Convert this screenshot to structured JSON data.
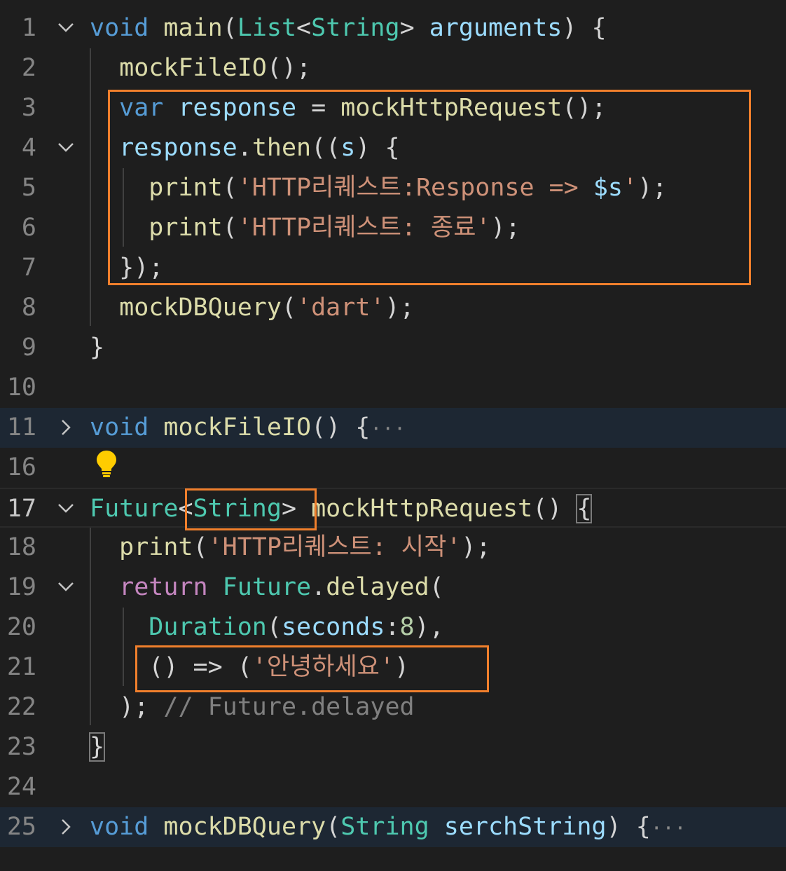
{
  "editor": {
    "theme_colors": {
      "background": "#1e1e1e",
      "keyword": "#569cd6",
      "control": "#c586c0",
      "function": "#dcdcaa",
      "type": "#4ec9b0",
      "variable": "#9cdcfe",
      "string": "#ce9178",
      "comment": "#808080",
      "highlight_box": "#f07f2c"
    },
    "lines": [
      {
        "num": "1",
        "fold": "expanded",
        "tokens": [
          [
            "void",
            "kw"
          ],
          [
            " "
          ],
          [
            "main",
            "fn"
          ],
          [
            "("
          ],
          [
            "List",
            "ty"
          ],
          [
            "<"
          ],
          [
            "String",
            "ty"
          ],
          [
            "> "
          ],
          [
            "arguments",
            "var"
          ],
          [
            ") {"
          ]
        ]
      },
      {
        "num": "2",
        "fold": "",
        "tokens": [
          [
            "  "
          ],
          [
            "mockFileIO",
            "fn"
          ],
          [
            "();"
          ]
        ]
      },
      {
        "num": "3",
        "fold": "",
        "tokens": [
          [
            "  "
          ],
          [
            "var",
            "kw"
          ],
          [
            " "
          ],
          [
            "response",
            "var"
          ],
          [
            " = "
          ],
          [
            "mockHttpRequest",
            "fn"
          ],
          [
            "();"
          ]
        ]
      },
      {
        "num": "4",
        "fold": "expanded",
        "tokens": [
          [
            "  "
          ],
          [
            "response",
            "var"
          ],
          [
            "."
          ],
          [
            "then",
            "fn"
          ],
          [
            "(("
          ],
          [
            "s",
            "var"
          ],
          [
            ") {"
          ]
        ]
      },
      {
        "num": "5",
        "fold": "",
        "tokens": [
          [
            "    "
          ],
          [
            "print",
            "fn"
          ],
          [
            "("
          ],
          [
            "'HTTP리퀘스트:Response => ",
            "str"
          ],
          [
            "$",
            "var"
          ],
          [
            "s",
            "var"
          ],
          [
            "'",
            "str"
          ],
          [
            ");"
          ]
        ]
      },
      {
        "num": "6",
        "fold": "",
        "tokens": [
          [
            "    "
          ],
          [
            "print",
            "fn"
          ],
          [
            "("
          ],
          [
            "'HTTP리퀘스트: 종료'",
            "str"
          ],
          [
            ");"
          ]
        ]
      },
      {
        "num": "7",
        "fold": "",
        "tokens": [
          [
            "  "
          ],
          [
            "});"
          ]
        ]
      },
      {
        "num": "8",
        "fold": "",
        "tokens": [
          [
            "  "
          ],
          [
            "mockDBQuery",
            "fn"
          ],
          [
            "("
          ],
          [
            "'dart'",
            "str"
          ],
          [
            ");"
          ]
        ]
      },
      {
        "num": "9",
        "fold": "",
        "tokens": [
          [
            "}"
          ]
        ]
      },
      {
        "num": "10",
        "fold": "",
        "tokens": []
      },
      {
        "num": "11",
        "fold": "collapsed",
        "tokens": [
          [
            "void",
            "kw"
          ],
          [
            " "
          ],
          [
            "mockFileIO",
            "fn"
          ],
          [
            "() {"
          ],
          [
            "···",
            "ellipsis"
          ]
        ]
      },
      {
        "num": "16",
        "fold": "",
        "tokens": []
      },
      {
        "num": "17",
        "fold": "expanded",
        "active": true,
        "tokens": [
          [
            "Future",
            "ty"
          ],
          [
            "<"
          ],
          [
            "String",
            "ty"
          ],
          [
            "> "
          ],
          [
            "mockHttpRequest",
            "fn"
          ],
          [
            "() "
          ],
          [
            "{",
            "bracket"
          ]
        ]
      },
      {
        "num": "18",
        "fold": "",
        "tokens": [
          [
            "  "
          ],
          [
            "print",
            "fn"
          ],
          [
            "("
          ],
          [
            "'HTTP리퀘스트: 시작'",
            "str"
          ],
          [
            ");"
          ]
        ]
      },
      {
        "num": "19",
        "fold": "expanded",
        "tokens": [
          [
            "  "
          ],
          [
            "return",
            "ctl"
          ],
          [
            " "
          ],
          [
            "Future",
            "ty"
          ],
          [
            "."
          ],
          [
            "delayed",
            "fn"
          ],
          [
            "("
          ]
        ]
      },
      {
        "num": "20",
        "fold": "",
        "tokens": [
          [
            "    "
          ],
          [
            "Duration",
            "ty"
          ],
          [
            "("
          ],
          [
            "seconds",
            "var"
          ],
          [
            ":"
          ],
          [
            "8",
            "num"
          ],
          [
            "),"
          ]
        ]
      },
      {
        "num": "21",
        "fold": "",
        "tokens": [
          [
            "    "
          ],
          [
            "() => ("
          ],
          [
            "'안녕하세요'",
            "str"
          ],
          [
            ")"
          ]
        ]
      },
      {
        "num": "22",
        "fold": "",
        "tokens": [
          [
            "  "
          ],
          [
            "); "
          ],
          [
            "// Future.delayed",
            "cmt"
          ]
        ]
      },
      {
        "num": "23",
        "fold": "",
        "tokens": [
          [
            "}",
            "bracket"
          ]
        ]
      },
      {
        "num": "24",
        "fold": "",
        "tokens": []
      },
      {
        "num": "25",
        "fold": "collapsed",
        "tokens": [
          [
            "void",
            "kw"
          ],
          [
            " "
          ],
          [
            "mockDBQuery",
            "fn"
          ],
          [
            "("
          ],
          [
            "String",
            "ty"
          ],
          [
            " "
          ],
          [
            "serchString",
            "var"
          ],
          [
            ") {"
          ],
          [
            "···",
            "ellipsis"
          ]
        ]
      }
    ],
    "lightbulb_icon": "lightbulb-icon"
  }
}
